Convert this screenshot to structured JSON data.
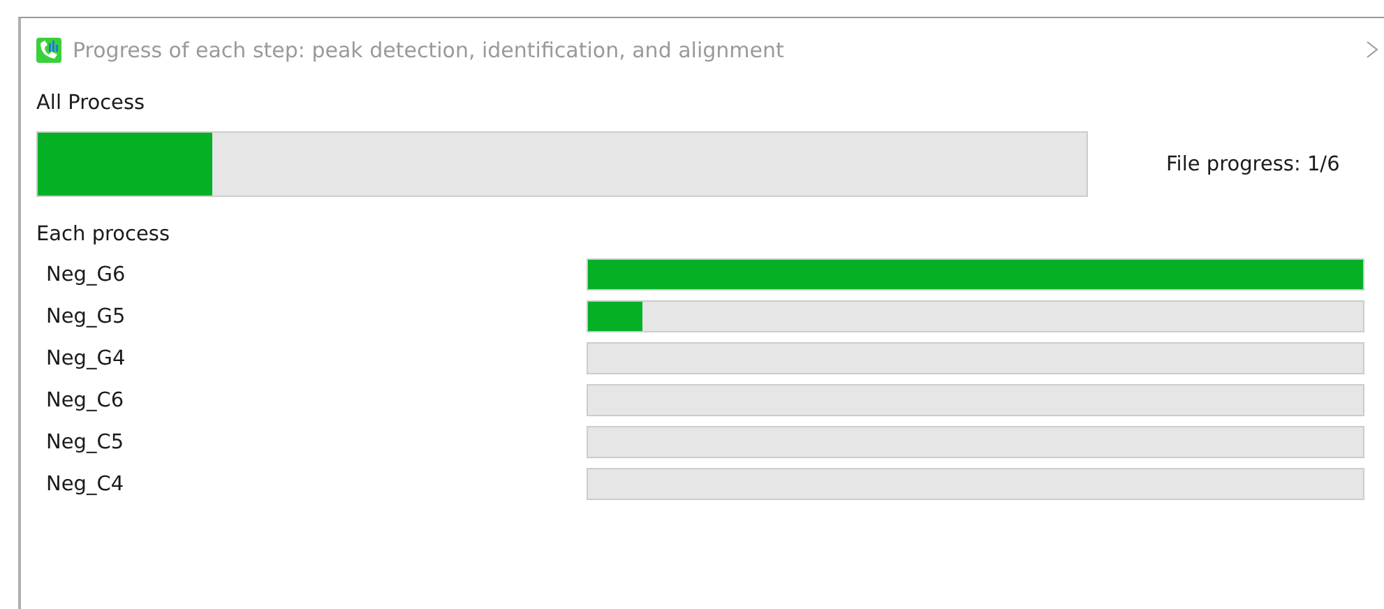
{
  "window": {
    "title": "Progress of each step: peak detection, identification, and alignment"
  },
  "all_process": {
    "label": "All Process",
    "level": 0.166,
    "file_progress": "File progress: 1/6"
  },
  "each_process": {
    "label": "Each process",
    "items": [
      {
        "name": "Neg_G6",
        "level": 1
      },
      {
        "name": "Neg_G5",
        "level": 0.07
      },
      {
        "name": "Neg_G4",
        "level": 0
      },
      {
        "name": "Neg_C6",
        "level": 0
      },
      {
        "name": "Neg_C5",
        "level": 0
      },
      {
        "name": "Neg_C4",
        "level": 0
      }
    ]
  }
}
